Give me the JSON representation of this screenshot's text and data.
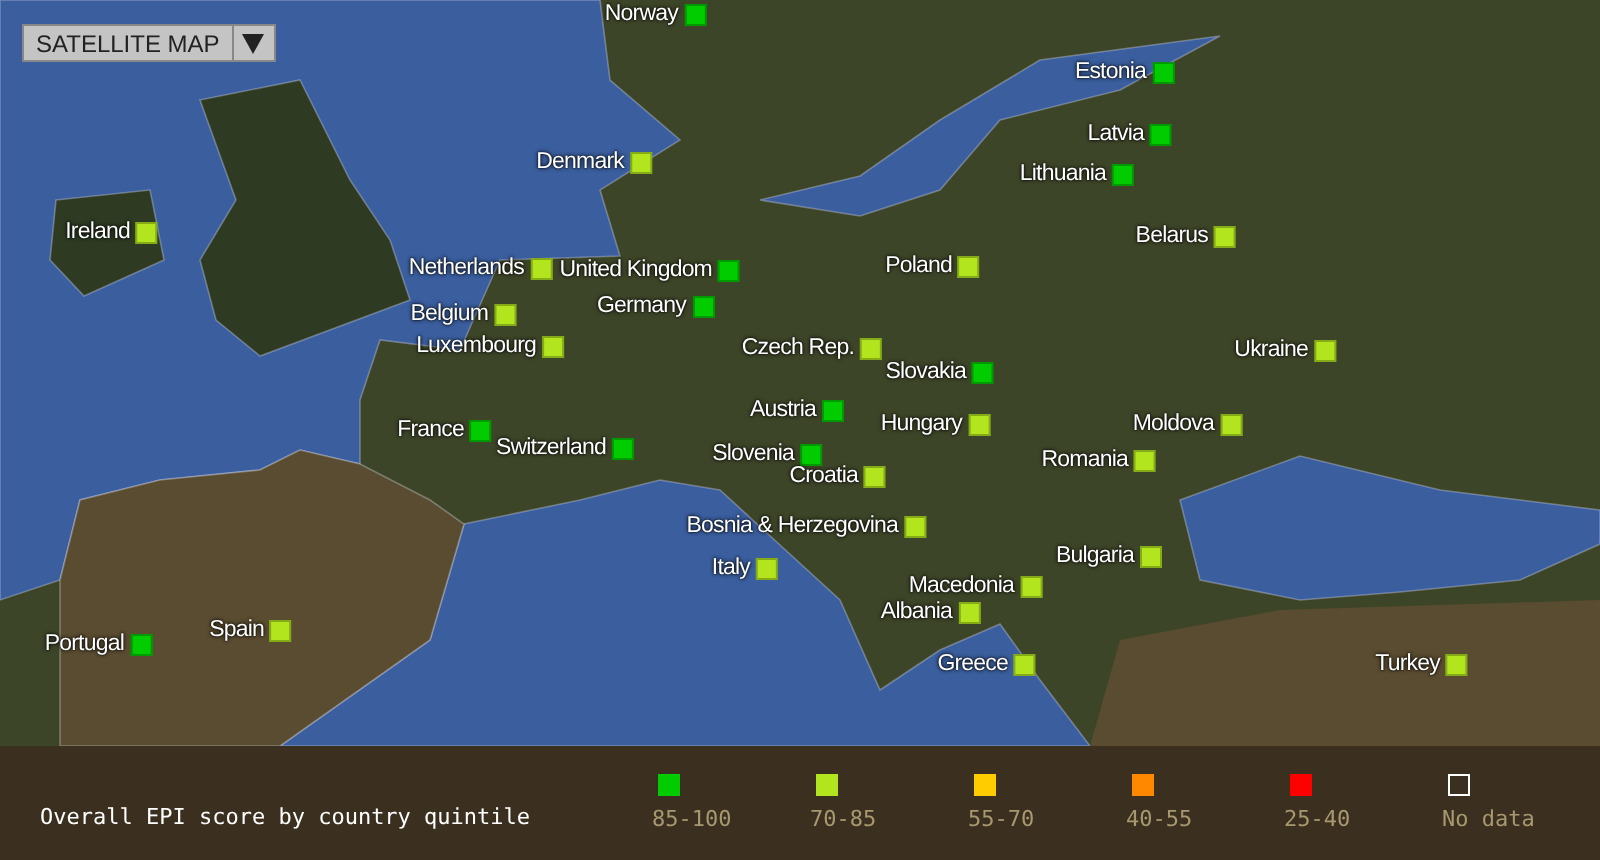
{
  "map_type_menu": {
    "label": "SATELLITE MAP"
  },
  "countries": [
    {
      "name": "Norway",
      "color": "#00cc00"
    },
    {
      "name": "Estonia",
      "color": "#00cc00"
    },
    {
      "name": "Latvia",
      "color": "#00cc00"
    },
    {
      "name": "Denmark",
      "color": "#b2e51e"
    },
    {
      "name": "Lithuania",
      "color": "#00cc00"
    },
    {
      "name": "Ireland",
      "color": "#b2e51e"
    },
    {
      "name": "Belarus",
      "color": "#b2e51e"
    },
    {
      "name": "Netherlands",
      "color": "#b2e51e"
    },
    {
      "name": "United Kingdom",
      "color": "#00cc00"
    },
    {
      "name": "Poland",
      "color": "#b2e51e"
    },
    {
      "name": "Germany",
      "color": "#00cc00"
    },
    {
      "name": "Belgium",
      "color": "#b2e51e"
    },
    {
      "name": "Luxembourg",
      "color": "#b2e51e"
    },
    {
      "name": "Czech Rep.",
      "color": "#b2e51e"
    },
    {
      "name": "Ukraine",
      "color": "#b2e51e"
    },
    {
      "name": "Slovakia",
      "color": "#00cc00"
    },
    {
      "name": "Austria",
      "color": "#00cc00"
    },
    {
      "name": "France",
      "color": "#00cc00"
    },
    {
      "name": "Hungary",
      "color": "#b2e51e"
    },
    {
      "name": "Moldova",
      "color": "#b2e51e"
    },
    {
      "name": "Switzerland",
      "color": "#00cc00"
    },
    {
      "name": "Slovenia",
      "color": "#00cc00"
    },
    {
      "name": "Romania",
      "color": "#b2e51e"
    },
    {
      "name": "Croatia",
      "color": "#b2e51e"
    },
    {
      "name": "Bosnia & Herzegovina",
      "color": "#b2e51e"
    },
    {
      "name": "Bulgaria",
      "color": "#b2e51e"
    },
    {
      "name": "Italy",
      "color": "#b2e51e"
    },
    {
      "name": "Macedonia",
      "color": "#b2e51e"
    },
    {
      "name": "Albania",
      "color": "#b2e51e"
    },
    {
      "name": "Spain",
      "color": "#b2e51e"
    },
    {
      "name": "Portugal",
      "color": "#00cc00"
    },
    {
      "name": "Greece",
      "color": "#b2e51e"
    },
    {
      "name": "Turkey",
      "color": "#b2e51e"
    }
  ],
  "legend": {
    "title": "Overall EPI score by country quintile",
    "items": [
      {
        "label": "85-100",
        "kind": "filled",
        "color": "#00cc00"
      },
      {
        "label": "70-85",
        "kind": "filled",
        "color": "#b2e51e"
      },
      {
        "label": "55-70",
        "kind": "filled",
        "color": "#ffcc00"
      },
      {
        "label": "40-55",
        "kind": "filled",
        "color": "#ff8800"
      },
      {
        "label": "25-40",
        "kind": "filled",
        "color": "#ff0000"
      },
      {
        "label": "No data",
        "kind": "empty"
      }
    ]
  }
}
